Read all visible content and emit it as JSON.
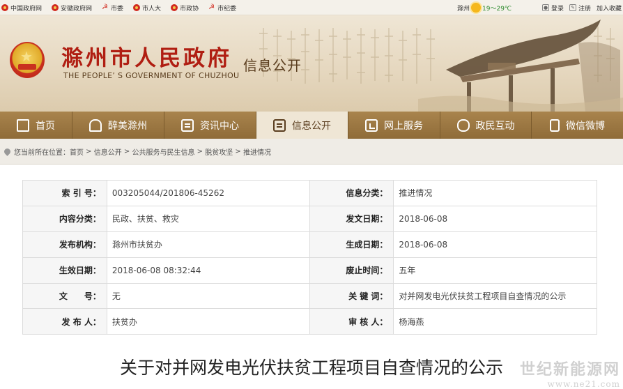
{
  "topbar": {
    "links": [
      {
        "label": "中国政府网",
        "icon": "national-emblem-icon"
      },
      {
        "label": "安徽政府网",
        "icon": "national-emblem-icon"
      },
      {
        "label": "市委",
        "icon": "party-emblem-icon"
      },
      {
        "label": "市人大",
        "icon": "national-emblem-icon"
      },
      {
        "label": "市政协",
        "icon": "cppcc-emblem-icon"
      },
      {
        "label": "市纪委",
        "icon": "party-emblem-icon"
      }
    ],
    "weather": {
      "city": "滁州",
      "temp": "19～29℃"
    },
    "login": "登录",
    "register": "注册",
    "favorite": "加入收藏"
  },
  "header": {
    "site_title": "滁州市人民政府",
    "site_subtitle": "THE PEOPLE’ S GOVERNMENT OF CHUZHOU",
    "section": "信息公开"
  },
  "nav": {
    "items": [
      {
        "label": "首页",
        "icon": "home-icon"
      },
      {
        "label": "醉美滁州",
        "icon": "pavilion-icon"
      },
      {
        "label": "资讯中心",
        "icon": "news-icon"
      },
      {
        "label": "信息公开",
        "icon": "book-icon",
        "active": true
      },
      {
        "label": "网上服务",
        "icon": "screen-icon"
      },
      {
        "label": "政民互动",
        "icon": "chat-icon"
      },
      {
        "label": "微信微博",
        "icon": "phone-icon"
      }
    ]
  },
  "breadcrumb": {
    "prefix": "您当前所在位置：",
    "items": [
      "首页",
      "信息公开",
      "公共服务与民生信息",
      "脱贫攻坚",
      "推进情况"
    ],
    "separator": " > "
  },
  "meta": {
    "rows": [
      [
        {
          "label": "索 引 号：",
          "value": "003205044/201806-45262"
        },
        {
          "label": "信息分类：",
          "value": "推进情况"
        }
      ],
      [
        {
          "label": "内容分类：",
          "value": "民政、扶贫、救灾"
        },
        {
          "label": "发文日期：",
          "value": "2018-06-08"
        }
      ],
      [
        {
          "label": "发布机构：",
          "value": "滁州市扶贫办"
        },
        {
          "label": "生成日期：",
          "value": "2018-06-08"
        }
      ],
      [
        {
          "label": "生效日期：",
          "value": "2018-06-08 08:32:44"
        },
        {
          "label": "废止时间：",
          "value": "五年"
        }
      ],
      [
        {
          "label": "文　　号：",
          "value": "无"
        },
        {
          "label": "关 键 词：",
          "value": "对并网发电光伏扶贫工程项目自查情况的公示"
        }
      ],
      [
        {
          "label": "发 布 人：",
          "value": "扶贫办"
        },
        {
          "label": "审 核 人：",
          "value": "杨海燕"
        }
      ]
    ]
  },
  "article": {
    "title": "关于对并网发电光伏扶贫工程项目自查情况的公示"
  },
  "watermark": {
    "line1": "世纪新能源网",
    "line2": "www.ne21.com"
  },
  "colors": {
    "title_red": "#b01e12",
    "nav_brown": "#9c7843",
    "nav_active_bg": "#efe6d5"
  }
}
